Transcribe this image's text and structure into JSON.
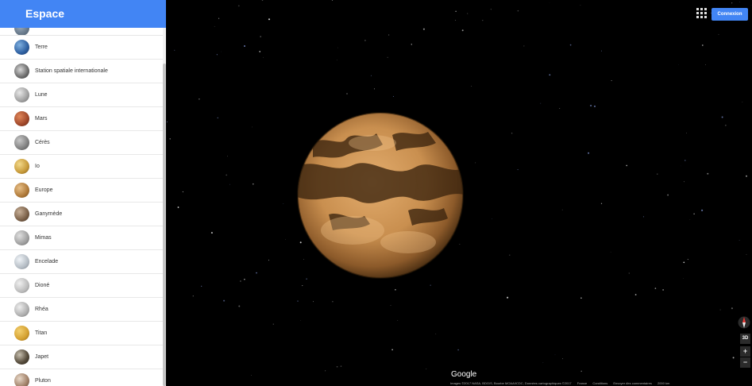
{
  "sidebar": {
    "title": "Espace",
    "items": [
      {
        "label": "Terre",
        "thumb": "earth"
      },
      {
        "label": "Station spatiale internationale",
        "thumb": "iss"
      },
      {
        "label": "Lune",
        "thumb": "moon"
      },
      {
        "label": "Mars",
        "thumb": "mars"
      },
      {
        "label": "Cérès",
        "thumb": "ceres"
      },
      {
        "label": "Io",
        "thumb": "io"
      },
      {
        "label": "Europe",
        "thumb": "europa"
      },
      {
        "label": "Ganymède",
        "thumb": "ganymede"
      },
      {
        "label": "Mimas",
        "thumb": "mimas"
      },
      {
        "label": "Encelade",
        "thumb": "enceladus"
      },
      {
        "label": "Dioné",
        "thumb": "dione"
      },
      {
        "label": "Rhéa",
        "thumb": "rhea"
      },
      {
        "label": "Titan",
        "thumb": "titan"
      },
      {
        "label": "Japet",
        "thumb": "iapetus"
      },
      {
        "label": "Pluton",
        "thumb": "pluto"
      }
    ]
  },
  "header": {
    "signin_label": "Connexion",
    "apps_icon": "apps-grid-icon"
  },
  "map": {
    "body_shown": "Titan",
    "logo_text": "Google",
    "controls": {
      "view3d_label": "3D",
      "zoom_in_label": "+",
      "zoom_out_label": "−"
    },
    "attribution": [
      "Images ©2017 NASA, BDG/S, Bourbe MOAA/ICDC, Données cartographiques ©2017",
      "France",
      "Conditions",
      "Envoyer des commentaires",
      "2000 km"
    ]
  },
  "colors": {
    "accent": "#4285f4",
    "sidebar_bg": "#ffffff",
    "space_bg": "#000000",
    "titan_light": "#d8a060",
    "titan_dark": "#3a2410"
  }
}
